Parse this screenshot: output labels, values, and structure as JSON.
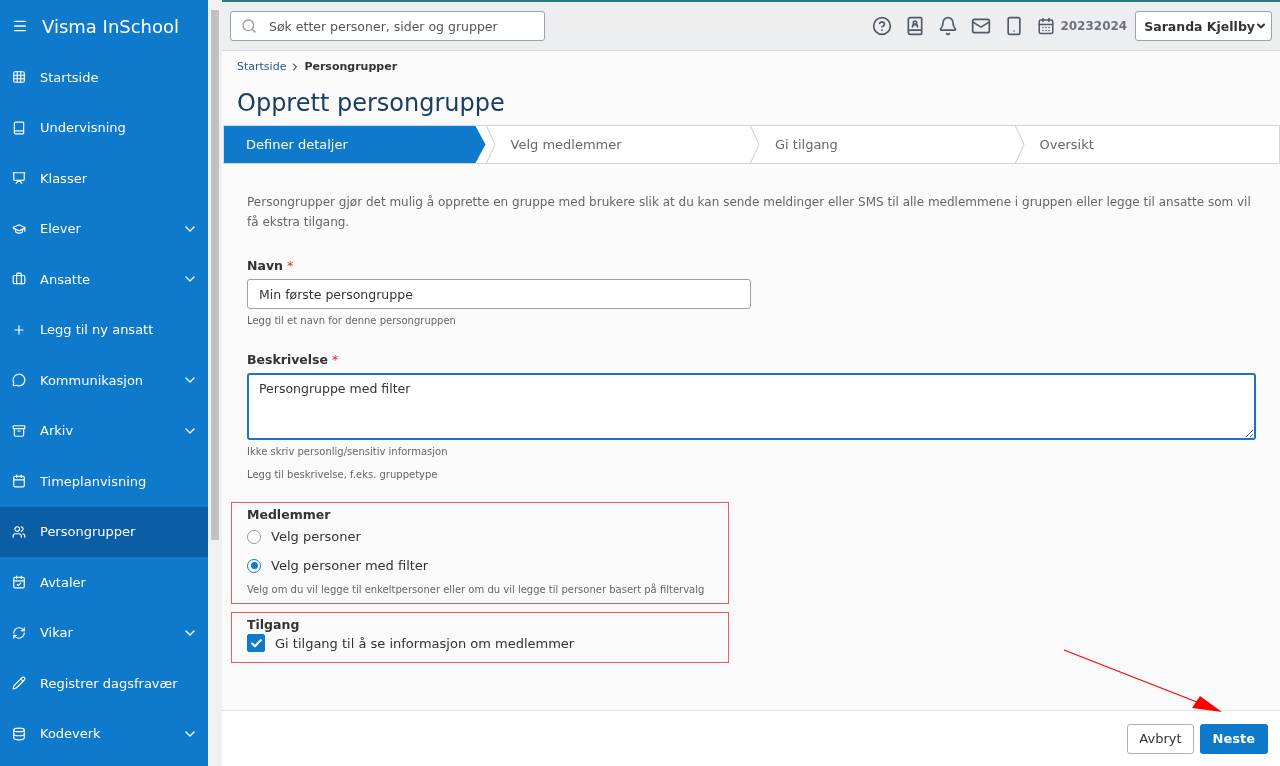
{
  "sidebar": {
    "title": "Visma InSchool",
    "items": [
      {
        "label": "Startside",
        "expandable": false,
        "selected": false
      },
      {
        "label": "Undervisning",
        "expandable": false,
        "selected": false
      },
      {
        "label": "Klasser",
        "expandable": false,
        "selected": false
      },
      {
        "label": "Elever",
        "expandable": true,
        "selected": false
      },
      {
        "label": "Ansatte",
        "expandable": true,
        "selected": false
      },
      {
        "label": "Legg til ny ansatt",
        "expandable": false,
        "selected": false
      },
      {
        "label": "Kommunikasjon",
        "expandable": true,
        "selected": false
      },
      {
        "label": "Arkiv",
        "expandable": true,
        "selected": false
      },
      {
        "label": "Timeplanvisning",
        "expandable": false,
        "selected": false
      },
      {
        "label": "Persongrupper",
        "expandable": false,
        "selected": true
      },
      {
        "label": "Avtaler",
        "expandable": false,
        "selected": false
      },
      {
        "label": "Vikar",
        "expandable": true,
        "selected": false
      },
      {
        "label": "Registrer dagsfravær",
        "expandable": false,
        "selected": false
      },
      {
        "label": "Kodeverk",
        "expandable": true,
        "selected": false
      }
    ]
  },
  "topbar": {
    "search": {
      "placeholder": "Søk etter personer, sider og grupper"
    },
    "school_year": "20232024",
    "user": "Saranda Kjellby"
  },
  "breadcrumb": [
    {
      "label": "Startside"
    },
    {
      "label": "Persongrupper"
    }
  ],
  "title": "Opprett persongruppe",
  "steps": [
    {
      "label": "Definer detaljer",
      "selected": true
    },
    {
      "label": "Velg medlemmer",
      "selected": false
    },
    {
      "label": "Gi tilgang",
      "selected": false
    },
    {
      "label": "Oversikt",
      "selected": false
    }
  ],
  "intro": "Persongrupper gjør det mulig å opprette en gruppe med brukere slik at du kan sende meldinger eller SMS til alle medlemmene i gruppen eller legge til ansatte som vil få ekstra tilgang.",
  "name_field": {
    "label": "Navn",
    "required_mark": "*",
    "value": "Min første persongruppe",
    "help": "Legg til et navn for denne persongruppen"
  },
  "description_field": {
    "label": "Beskrivelse",
    "required_mark": "*",
    "value": "Persongruppe med filter",
    "helps": [
      "Ikke skriv personlig/sensitiv informasjon",
      "Legg til beskrivelse, f.eks. gruppetype"
    ]
  },
  "members": {
    "legend": "Medlemmer",
    "options": [
      {
        "label": "Velg personer",
        "selected": false
      },
      {
        "label": "Velg personer med filter",
        "selected": true
      }
    ],
    "help": "Velg om du vil legge til enkeltpersoner eller om du vil legge til personer basert på filtervalg"
  },
  "access": {
    "legend": "Tilgang",
    "checkbox": {
      "label": "Gi tilgang til å se informasjon om medlemmer",
      "checked": true
    }
  },
  "buttons": {
    "cancel": "Avbryt",
    "next": "Neste"
  }
}
